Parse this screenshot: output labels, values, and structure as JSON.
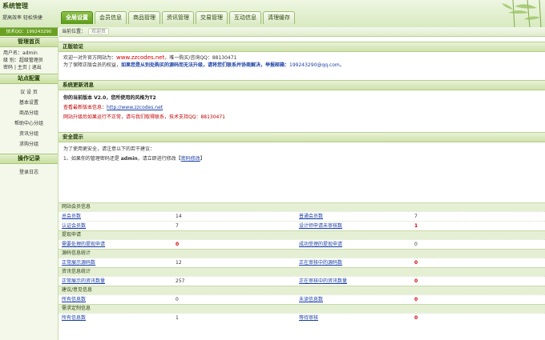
{
  "header": {
    "title": "系统管理",
    "subtitle": "提高效率  轻松快捷",
    "support": "技术QQ：199243290"
  },
  "nav": {
    "tabs": [
      {
        "label": "全局设置",
        "active": true
      },
      {
        "label": "会员信息",
        "active": false
      },
      {
        "label": "商品管理",
        "active": false
      },
      {
        "label": "资讯管理",
        "active": false
      },
      {
        "label": "交易管理",
        "active": false
      },
      {
        "label": "互动信息",
        "active": false
      },
      {
        "label": "清理缓存",
        "active": false
      }
    ]
  },
  "sidebar": {
    "admin_head": "管理首页",
    "user_label": "用户名：",
    "user_value": "admin",
    "level_label": "级  别：",
    "level_value": "超级管理员",
    "pwd_link": "密码",
    "home_link": "主页",
    "logout_link": "退出",
    "sep": "|",
    "site_head": "站点配置",
    "site_items": [
      "议 设 页",
      "基本设置",
      "商品分组",
      "帮助中心分组",
      "资讯分组",
      "求购分组"
    ],
    "log_head": "操作记录",
    "log_items": [
      "登录日志"
    ]
  },
  "breadcrumb": {
    "label": "当前位置：",
    "current": "欢迎页"
  },
  "sections": {
    "legal_title": "正版验证",
    "legal_line1_pre": "欢迎一对外官方网站为：",
    "legal_line1_url": "www.zzcodes.net",
    "legal_line1_post": "，唯一购买/咨询QQ：88130471",
    "legal_line2_pre": "为了保障正版会员的权益，",
    "legal_line2_bold": "如果您是从别处购买的源码而无法升级，请将您们联系并协商解决，举报邮箱：",
    "legal_line2_mail": "199243290@qq.com。",
    "update_title": "系统更新消息",
    "version_line": "你的当前版本 V2.0，您所使用的风格为T2",
    "latest_pre": "查看最新版本信息：",
    "latest_url": "http://www.zzcodes.net",
    "upgrade_note": "网站升级后如果运行不正常，请与我们取得联系，技术支持QQ：88130471",
    "security_title": "安全提示",
    "security_intro": "为了使用更安全，请注意以下的若干建议：",
    "security_tip_pre": "1、如果你的管理密码还是 ",
    "security_tip_admin": "admin",
    "security_tip_mid": "，请立即进行修改【",
    "security_tip_link": "密码修改",
    "security_tip_post": "】"
  },
  "stats": {
    "groups": [
      {
        "title": "网站会员信息",
        "rows": [
          [
            "总会员数",
            "14",
            "普通会员数",
            "7",
            false,
            false
          ],
          [
            "认证会员数",
            "7",
            "设计师申请未审核数",
            "1",
            false,
            true
          ]
        ]
      },
      {
        "title": "提现申请",
        "rows": [
          [
            "需要处理的提现申请",
            "0",
            "成功受理的提现申请",
            "0",
            true,
            false
          ]
        ]
      },
      {
        "title": "源码信息统计",
        "rows": [
          [
            "正常展示源码数",
            "12",
            "正在审核中的源码数",
            "0",
            false,
            true
          ]
        ]
      },
      {
        "title": "资讯信息统计",
        "rows": [
          [
            "正常展示的资讯数量",
            "257",
            "正在审核中的资讯数量",
            "0",
            false,
            true
          ]
        ]
      },
      {
        "title": "建议/意见信息",
        "rows": [
          [
            "所有信息数",
            "0",
            "未读信息数",
            "0",
            false,
            true
          ]
        ]
      },
      {
        "title": "需求定制信息",
        "rows": [
          [
            "所有信息数",
            "1",
            "等待审核",
            "0",
            false,
            true
          ]
        ]
      }
    ]
  },
  "colors": {
    "accent": "#6aa122",
    "header_bg": "#d8eac0",
    "warn": "#d10000"
  }
}
